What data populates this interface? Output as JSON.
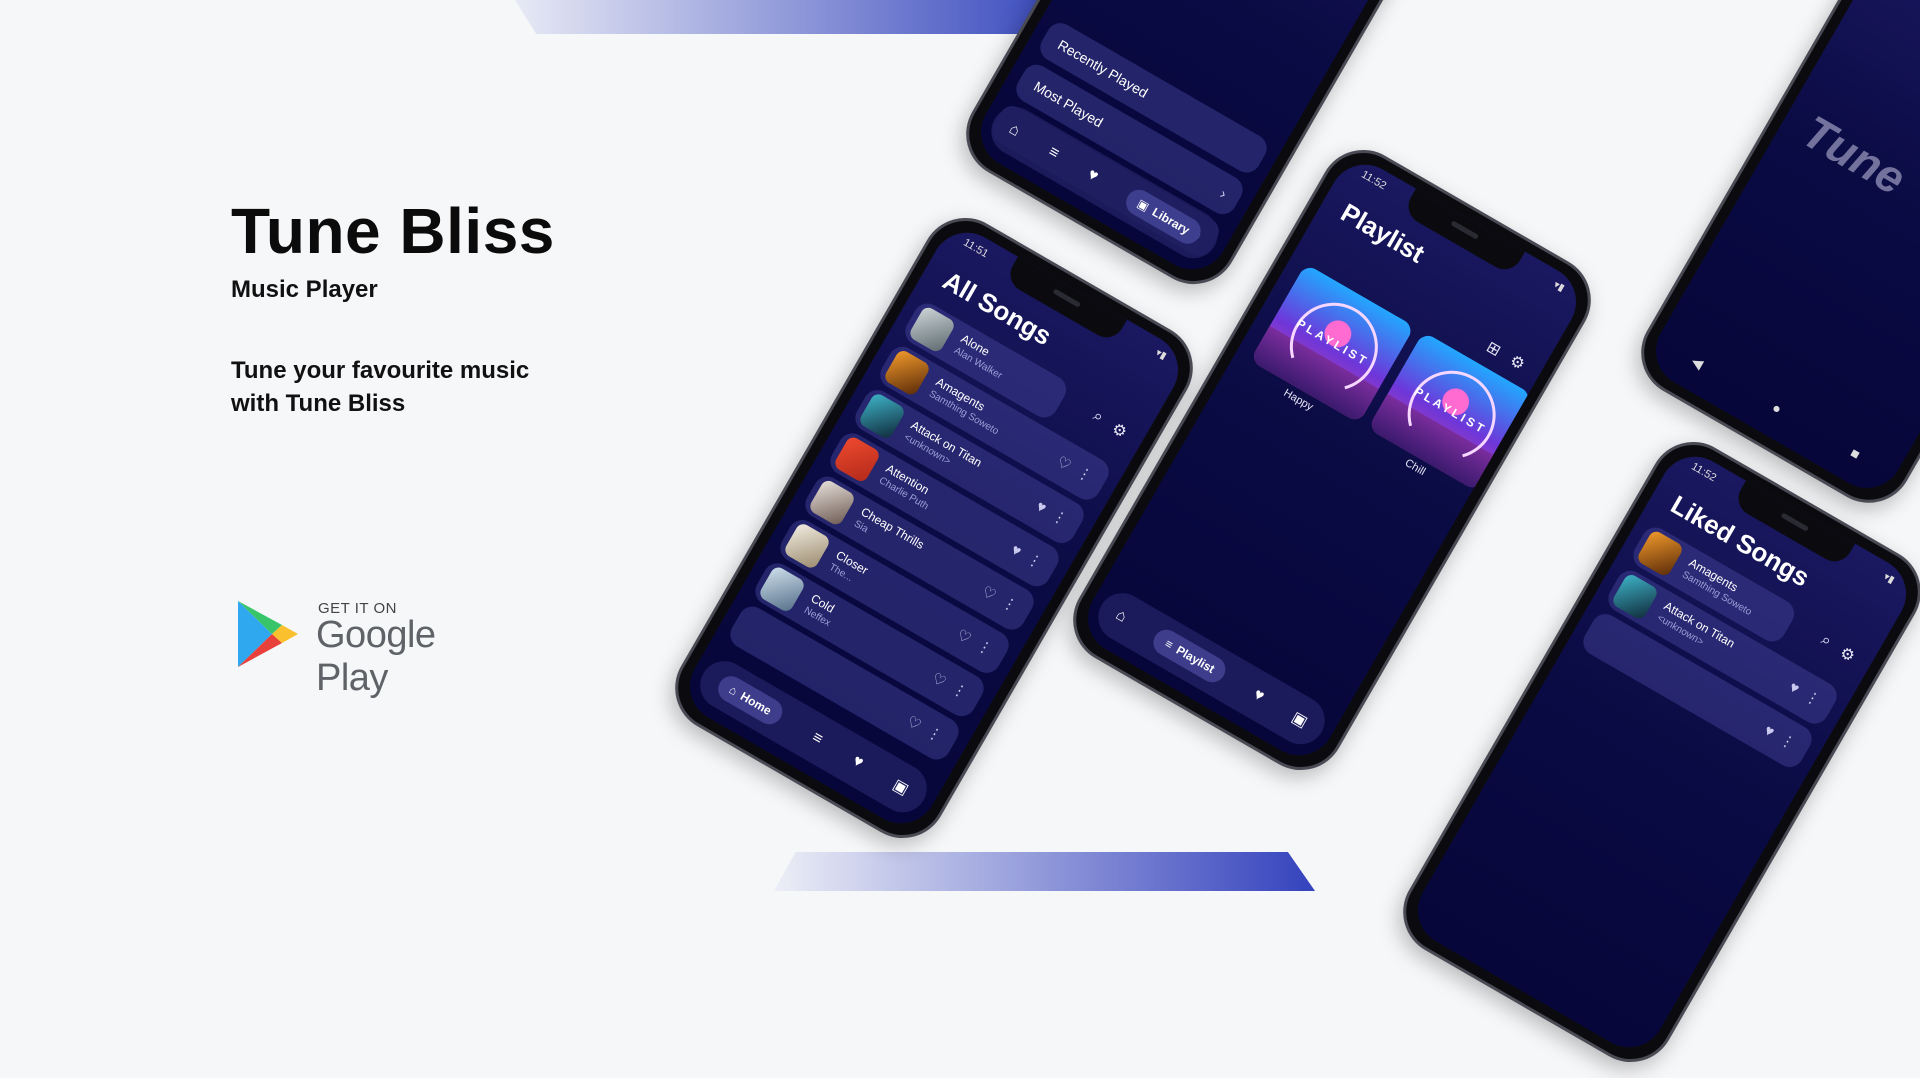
{
  "hero": {
    "title": "Tune Bliss",
    "subtitle": "Music Player",
    "tagline_line1": "Tune your favourite music",
    "tagline_line2": "with Tune Bliss"
  },
  "store_badge": {
    "get_it_on": "GET IT ON",
    "store_name": "Google Play"
  },
  "library_phone": {
    "rows": [
      "Recently Played",
      "Most Played"
    ],
    "nav": {
      "active_label": "Library"
    }
  },
  "all_songs_phone": {
    "time": "11:51",
    "title": "All Songs",
    "songs": [
      {
        "title": "Alone",
        "artist": "Alan Walker",
        "liked": false
      },
      {
        "title": "Amagents",
        "artist": "Samthing Soweto",
        "liked": false
      },
      {
        "title": "Attack on Titan",
        "artist": "<unknown>",
        "liked": true
      },
      {
        "title": "Attention",
        "artist": "Charlie Puth",
        "liked": true
      },
      {
        "title": "Cheap Thrills",
        "artist": "Sia",
        "liked": false
      },
      {
        "title": "Closer",
        "artist": "The...",
        "liked": false
      },
      {
        "title": "Cold",
        "artist": "Neffex",
        "liked": false
      }
    ],
    "nav": {
      "active_label": "Home"
    }
  },
  "playlist_phone": {
    "time": "11:52",
    "title": "Playlist",
    "playlists": [
      {
        "name": "Happy",
        "art_text": "PLAYLIST"
      },
      {
        "name": "Chill",
        "art_text": "PLAYLIST"
      }
    ],
    "nav": {
      "active_label": "Playlist"
    }
  },
  "liked_phone": {
    "time": "11:52",
    "title": "Liked Songs",
    "songs": [
      {
        "title": "Amagents",
        "artist": "Samthing Soweto"
      },
      {
        "title": "Attack on Titan",
        "artist": "<unknown>"
      }
    ]
  },
  "splash_phone": {
    "logo_text": "Tune"
  },
  "colors": {
    "background": "#f6f7f9",
    "screen_top": "#1a1860",
    "screen_bottom": "#06063a",
    "accent_band": "#3f4fc0"
  }
}
